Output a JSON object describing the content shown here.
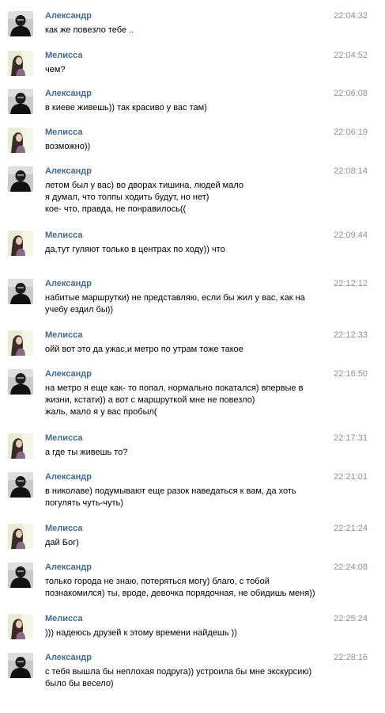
{
  "messages": [
    {
      "author": "Александр",
      "avatar": "avatar-aleksandr",
      "time": "22:04:32",
      "lines": [
        "как же повезло тебе .."
      ]
    },
    {
      "author": "Мелисса",
      "avatar": "avatar-melissa",
      "time": "22:04:52",
      "lines": [
        "чем?"
      ]
    },
    {
      "author": "Александр",
      "avatar": "avatar-aleksandr",
      "time": "22:06:08",
      "lines": [
        "в киеве живешь)) так красиво у вас там)"
      ]
    },
    {
      "author": "Мелисса",
      "avatar": "avatar-melissa",
      "time": "22:06:19",
      "lines": [
        "возможно))"
      ]
    },
    {
      "author": "Александр",
      "avatar": "avatar-aleksandr",
      "time": "22:08:14",
      "lines": [
        "летом был у вас) во дворах тишина, людей мало",
        "я думал, что толпы ходить будут, но нет)",
        "кое- что, правда, не понравилось(("
      ]
    },
    {
      "author": "Мелисса",
      "avatar": "avatar-melissa",
      "time": "22:09:44",
      "lines": [
        "да,тут гуляют только в центрах по ходу)) что"
      ]
    },
    {
      "author": "Александр",
      "avatar": "avatar-aleksandr",
      "time": "22:12:12",
      "lines": [
        "набитые маршрутки) не представляю, если бы жил у вас, как на",
        "учебу ездил бы))"
      ]
    },
    {
      "author": "Мелисса",
      "avatar": "avatar-melissa",
      "time": "22:12:33",
      "lines": [
        "ойй вот это да ужас,и метро по утрам тоже такое"
      ]
    },
    {
      "author": "Александр",
      "avatar": "avatar-aleksandr",
      "time": "22:16:50",
      "lines": [
        "на метро я еще как- то попал, нормально покатался) впервые в",
        "жизни, кстати)) а вот с маршруткой мне не повезло)",
        "жаль, мало я у вас пробыл("
      ]
    },
    {
      "author": "Мелисса",
      "avatar": "avatar-melissa",
      "time": "22:17:31",
      "lines": [
        "а где ты живешь то?"
      ]
    },
    {
      "author": "Александр",
      "avatar": "avatar-aleksandr",
      "time": "22:21:01",
      "lines": [
        "в николаве) подумывают еще разок наведаться к вам, да хоть",
        "погулять чуть-чуть)"
      ]
    },
    {
      "author": "Мелисса",
      "avatar": "avatar-melissa",
      "time": "22:21:24",
      "lines": [
        "дай Бог)"
      ]
    },
    {
      "author": "Александр",
      "avatar": "avatar-aleksandr",
      "time": "22:24:08",
      "lines": [
        "только города не знаю, потеряться могу) благо, с тобой",
        "познакомился) ты, вроде, девочка порядочная, не обидишь меня))"
      ]
    },
    {
      "author": "Мелисса",
      "avatar": "avatar-melissa",
      "time": "22:25:24",
      "lines": [
        "))) надеюсь друзей к этому времени найдешь ))"
      ]
    },
    {
      "author": "Александр",
      "avatar": "avatar-aleksandr",
      "time": "22:28:16",
      "lines": [
        "с тебя вышла бы неплохая подруга)) устроила бы мне экскурсию)",
        "было бы весело)"
      ]
    }
  ]
}
